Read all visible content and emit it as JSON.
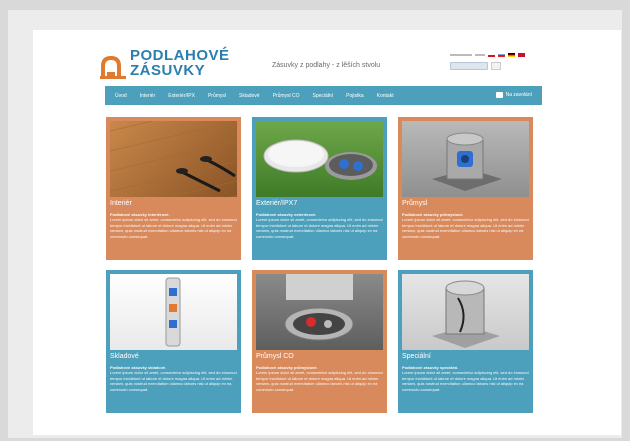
{
  "header": {
    "logo_line1": "PODLAHOVÉ",
    "logo_line2": "ZÁSUVKY",
    "tagline": "Zásuvky z podlahy - z lěších stvolu"
  },
  "nav": {
    "items": [
      "Úvod",
      "Interiér",
      "Exteriér/IPX",
      "Průmysl",
      "Skladové",
      "Průmysl CO",
      "Speciální",
      "Pojistka",
      "Kontakt"
    ],
    "contact_label": "Na zavolání"
  },
  "cards": [
    {
      "title": "Interiér",
      "color": "orange",
      "desc_bold": "Podlahové zásuvky interiérové.",
      "desc": "Lorem ipsum dolor sit amet, consectetur adipiscing elit, sed do eiusmod tempor incididunt ut labore et dolore magna aliqua. Ut enim ad minim veniam, quis nostrud exercitation ullamco laboris nisi ut aliquip ex ea commodo consequat."
    },
    {
      "title": "Exteriér/IPX7",
      "color": "blue",
      "desc_bold": "Podlahové zásuvky exteriérové.",
      "desc": "Lorem ipsum dolor sit amet, consectetur adipiscing elit, sed do eiusmod tempor incididunt ut labore et dolore magna aliqua. Ut enim ad minim veniam, quis nostrud exercitation ullamco laboris nisi ut aliquip ex ea commodo consequat."
    },
    {
      "title": "Průmysl",
      "color": "orange",
      "desc_bold": "Podlahové zásuvky průmyslové.",
      "desc": "Lorem ipsum dolor sit amet, consectetur adipiscing elit, sed do eiusmod tempor incididunt ut labore et dolore magna aliqua. Ut enim ad minim veniam, quis nostrud exercitation ullamco laboris nisi ut aliquip ex ea commodo consequat."
    },
    {
      "title": "Skladové",
      "color": "blue",
      "desc_bold": "Podlahové zásuvky skladové.",
      "desc": "Lorem ipsum dolor sit amet, consectetur adipiscing elit, sed do eiusmod tempor incididunt ut labore et dolore magna aliqua. Ut enim ad minim veniam, quis nostrud exercitation ullamco laboris nisi ut aliquip ex ea commodo consequat."
    },
    {
      "title": "Průmysl CO",
      "color": "orange",
      "desc_bold": "Podlahové zásuvky průmyslové.",
      "desc": "Lorem ipsum dolor sit amet, consectetur adipiscing elit, sed do eiusmod tempor incididunt ut labore et dolore magna aliqua. Ut enim ad minim veniam, quis nostrud exercitation ullamco laboris nisi ut aliquip ex ea commodo consequat."
    },
    {
      "title": "Speciální",
      "color": "blue",
      "desc_bold": "Podlahové zásuvky speciální.",
      "desc": "Lorem ipsum dolor sit amet, consectetur adipiscing elit, sed do eiusmod tempor incididunt ut labore et dolore magna aliqua. Ut enim ad minim veniam, quis nostrud exercitation ullamco laboris nisi ut aliquip ex ea commodo consequat."
    }
  ],
  "colors": {
    "brand_blue": "#4da0bc",
    "brand_orange": "#d88a5c",
    "logo_blue": "#2b7fae",
    "logo_orange": "#e07a2e"
  }
}
